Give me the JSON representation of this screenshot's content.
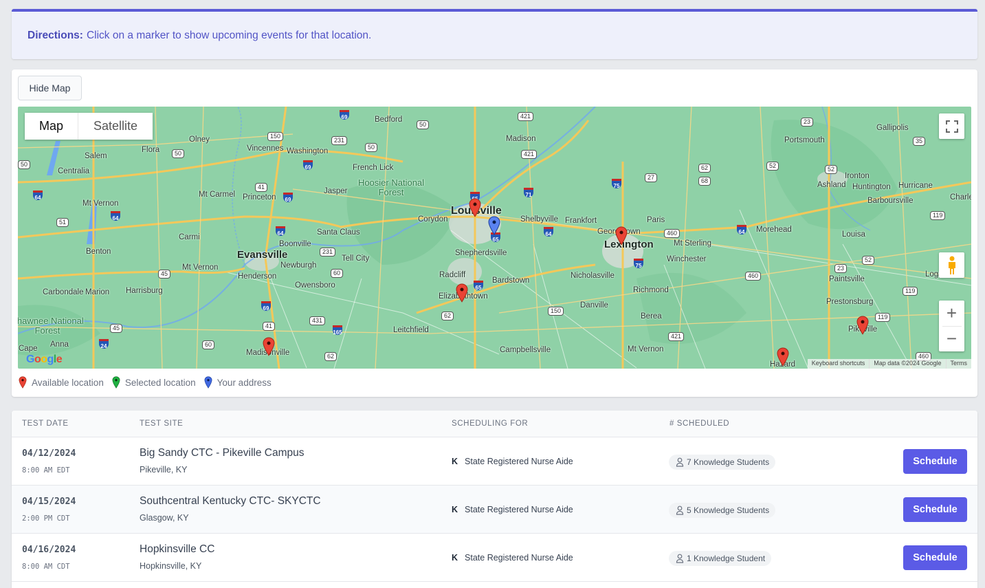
{
  "directions": {
    "label": "Directions:",
    "text": "Click on a marker to show upcoming events for that location."
  },
  "map_card": {
    "hide_map_label": "Hide Map",
    "map_type": {
      "map": "Map",
      "satellite": "Satellite",
      "selected": "Map"
    },
    "attribution": {
      "keyboard": "Keyboard shortcuts",
      "map_data": "Map data ©2024 Google",
      "terms": "Terms"
    },
    "google_logo": "Google",
    "zoom_in": "+",
    "zoom_out": "−",
    "icons": {
      "fullscreen": "fullscreen-icon",
      "pegman": "street-view-pegman-icon",
      "zoom_in": "zoom-in-icon",
      "zoom_out": "zoom-out-icon"
    },
    "cities": [
      {
        "name": "Olney",
        "big": false
      },
      {
        "name": "Flora",
        "big": false
      },
      {
        "name": "Salem",
        "big": false
      },
      {
        "name": "Centralia",
        "big": false
      },
      {
        "name": "Mt Vernon",
        "big": false
      },
      {
        "name": "Vincennes",
        "big": false
      },
      {
        "name": "Washington",
        "big": false
      },
      {
        "name": "Bedford",
        "big": false
      },
      {
        "name": "Madison",
        "big": false
      },
      {
        "name": "French Lick",
        "big": false
      },
      {
        "name": "Jasper",
        "big": false
      },
      {
        "name": "Mt Carmel",
        "big": false
      },
      {
        "name": "Princeton",
        "big": false
      },
      {
        "name": "Carmi",
        "big": false
      },
      {
        "name": "Benton",
        "big": false
      },
      {
        "name": "Evansville",
        "big": true
      },
      {
        "name": "Boonville",
        "big": false
      },
      {
        "name": "Santa Claus",
        "big": false
      },
      {
        "name": "Newburgh",
        "big": false
      },
      {
        "name": "Henderson",
        "big": false
      },
      {
        "name": "Mt Vernon",
        "big": false
      },
      {
        "name": "Tell City",
        "big": false
      },
      {
        "name": "Owensboro",
        "big": false
      },
      {
        "name": "Carbondale",
        "big": false
      },
      {
        "name": "Marion",
        "big": false
      },
      {
        "name": "Harrisburg",
        "big": false
      },
      {
        "name": "Anna",
        "big": false
      },
      {
        "name": "Cape",
        "big": false
      },
      {
        "name": "Madisonville",
        "big": false
      },
      {
        "name": "Leitchfield",
        "big": false
      },
      {
        "name": "Louisville",
        "big": true
      },
      {
        "name": "Corydon",
        "big": false
      },
      {
        "name": "Shepherdsville",
        "big": false
      },
      {
        "name": "Radcliff",
        "big": false
      },
      {
        "name": "Elizabethtown",
        "big": false
      },
      {
        "name": "Bardstown",
        "big": false
      },
      {
        "name": "Campbellsville",
        "big": false
      },
      {
        "name": "Shelbyville",
        "big": false
      },
      {
        "name": "Frankfort",
        "big": false
      },
      {
        "name": "Georgetown",
        "big": false
      },
      {
        "name": "Lexington",
        "big": true
      },
      {
        "name": "Paris",
        "big": false
      },
      {
        "name": "Nicholasville",
        "big": false
      },
      {
        "name": "Richmond",
        "big": false
      },
      {
        "name": "Danville",
        "big": false
      },
      {
        "name": "Berea",
        "big": false
      },
      {
        "name": "Mt Vernon",
        "big": false
      },
      {
        "name": "Winchester",
        "big": false
      },
      {
        "name": "Mt Sterling",
        "big": false
      },
      {
        "name": "Morehead",
        "big": false
      },
      {
        "name": "Portsmouth",
        "big": false
      },
      {
        "name": "Gallipolis",
        "big": false
      },
      {
        "name": "Ironton",
        "big": false
      },
      {
        "name": "Ashland",
        "big": false
      },
      {
        "name": "Huntington",
        "big": false
      },
      {
        "name": "Hurricane",
        "big": false
      },
      {
        "name": "Barboursville",
        "big": false
      },
      {
        "name": "Charle",
        "big": false
      },
      {
        "name": "Louisa",
        "big": false
      },
      {
        "name": "Paintsville",
        "big": false
      },
      {
        "name": "Prestonsburg",
        "big": false
      },
      {
        "name": "Logan",
        "big": false
      },
      {
        "name": "Pikeville",
        "big": false
      },
      {
        "name": "Hazard",
        "big": false
      }
    ],
    "forests": [
      "Hoosier National Forest",
      "Shawnee National Forest"
    ],
    "markers": [
      {
        "location": "Louisville",
        "type": "available"
      },
      {
        "location": "Your address (Louisville)",
        "type": "address"
      },
      {
        "location": "Georgetown",
        "type": "available"
      },
      {
        "location": "Elizabethtown",
        "type": "available"
      },
      {
        "location": "Madisonville",
        "type": "available"
      },
      {
        "location": "Pikeville",
        "type": "available"
      },
      {
        "location": "Hazard",
        "type": "available"
      }
    ],
    "legend": [
      {
        "label": "Available location",
        "color": "#ea4335"
      },
      {
        "label": "Selected location",
        "color": "#1fb141"
      },
      {
        "label": "Your address",
        "color": "#4169e1"
      }
    ]
  },
  "table": {
    "headers": [
      "TEST DATE",
      "TEST SITE",
      "SCHEDULING FOR",
      "# SCHEDULED"
    ],
    "rows": [
      {
        "date": "04/12/2024",
        "time": "8:00 AM EDT",
        "site": "Big Sandy CTC - Pikeville Campus",
        "city": "Pikeville, KY",
        "type_letter": "K",
        "scheduling_for": "State Registered Nurse Aide",
        "scheduled": "7 Knowledge Students",
        "action": "Schedule"
      },
      {
        "date": "04/15/2024",
        "time": "2:00 PM CDT",
        "site": "Southcentral Kentucky CTC- SKYCTC",
        "city": "Glasgow, KY",
        "type_letter": "K",
        "scheduling_for": "State Registered Nurse Aide",
        "scheduled": "5 Knowledge Students",
        "action": "Schedule"
      },
      {
        "date": "04/16/2024",
        "time": "8:00 AM CDT",
        "site": "Hopkinsville CC",
        "city": "Hopkinsville, KY",
        "type_letter": "K",
        "scheduling_for": "State Registered Nurse Aide",
        "scheduled": "1 Knowledge Student",
        "action": "Schedule"
      }
    ]
  },
  "colors": {
    "accent": "#5b5be6",
    "directions_bg": "#eef0fb",
    "directions_text": "#5254c6",
    "map_land": "#8fd1a7",
    "marker_available": "#ea4335",
    "marker_selected": "#1fb141",
    "marker_address": "#4169e1"
  }
}
